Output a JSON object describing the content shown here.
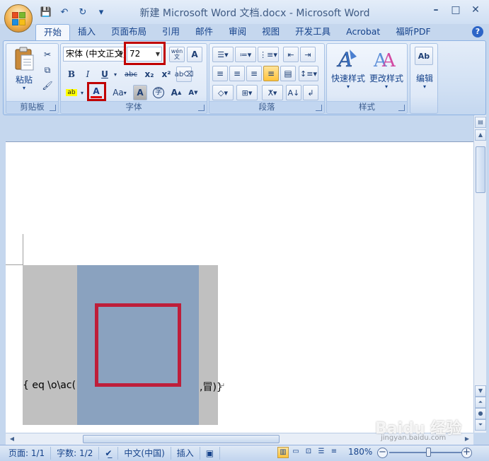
{
  "window": {
    "title": "新建 Microsoft Word 文档.docx - Microsoft Word",
    "controls": [
      "–",
      "□",
      "✕"
    ]
  },
  "qat": {
    "save": "💾",
    "undo": "↶",
    "redo": "↻",
    "customize": "▾"
  },
  "tabs": [
    "开始",
    "插入",
    "页面布局",
    "引用",
    "邮件",
    "审阅",
    "视图",
    "开发工具",
    "Acrobat",
    "福昕PDF"
  ],
  "help": "?",
  "ribbon": {
    "clipboard": {
      "label": "剪贴板",
      "paste": "粘贴"
    },
    "font": {
      "label": "字体",
      "font_name": "宋体 (中文正文)",
      "font_size": "72",
      "wen": "wén\n文",
      "bold": "B",
      "italic": "I",
      "underline": "U",
      "strike": "abc",
      "subscript": "x₂",
      "superscript": "x²",
      "case": "Aa",
      "grow": "A",
      "shrink": "A"
    },
    "paragraph": {
      "label": "段落"
    },
    "styles": {
      "label": "样式",
      "quick": "快速样式",
      "change": "更改样式"
    },
    "editing": {
      "label": "编辑"
    }
  },
  "document": {
    "field_code_start": "{ eq \\o\\ac(",
    "field_code_end": ",冒)}",
    "para_mark": "↵"
  },
  "statusbar": {
    "page": "页面: 1/1",
    "words": "字数: 1/2",
    "language": "中文(中国)",
    "insert": "插入",
    "zoom": "180%"
  },
  "watermark": {
    "main": "Baidu 经验",
    "sub": "jingyan.baidu.com"
  },
  "colors": {
    "highlight_red": "#c00000",
    "square_red": "#be1e3a",
    "char_shading": "#c0c0c0",
    "enclose_blue": "#8aa2bf"
  }
}
